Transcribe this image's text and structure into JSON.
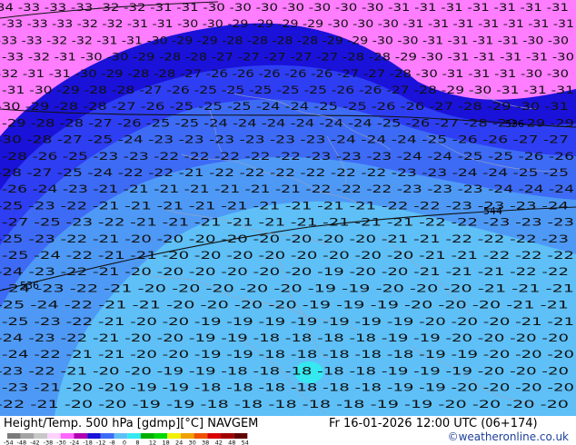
{
  "map": {
    "title": "Height/Temp. 500 hPa [gdmp][°C] NAVGEM",
    "valid_time": "Fr 16-01-2026 12:00 UTC (06+174)",
    "credit": "©weatheronline.co.uk",
    "fill_colors": [
      "#ff7dff",
      "#1a12d8",
      "#2e3ef3",
      "#3d6bf5",
      "#4e99f6",
      "#5ec0f7",
      "#36e8f0"
    ],
    "contour_labels": [
      {
        "text": "544"
      },
      {
        "text": "536"
      },
      {
        "text": "536"
      }
    ],
    "temperature_rows": [
      "34 -33 -33 -33 -32 -32 -31 -31 -30 -30 -30 -30 -30 -30 -30 -31 -31 -31 -31 -31 -31 -31",
      "-33 -33 -33 -32 -32 -31 -31 -30 -30 -29 -29 -29 -29 -30 -30 -30 -31 -31 -31 -31 -31 -31 -31",
      "-33 -33 -32 -32 -31 -31 -30 -29 -29 -28 -28 -28 -28 -29 -29 -30 -30 -31 -31 -31 -31 -30 -30",
      "-33 -32 -31 -30 -30 -29 -28 -28 -27 -27 -27 -27 -27 -28 -28 -29 -30 -31 -31 -31 -31 -30",
      "-32 -31 -31 -30 -29 -28 -28 -27 -26 -26 -26 -26 -26 -27 -27 -28 -30 -31 -31 -31 -30 -30",
      "-31 -30 -29 -28 -28 -27 -26 -25 -25 -25 -25 -25 -26 -26 -27 -28 -29 -30 -31 -31 -31",
      "-30 -29 -28 -28 -27 -26 -25 -25 -25 -24 -24 -25 -25 -26 -26 -27 -28 -29 -30 -31",
      "-29 -28 -28 -27 -26 -25 -25 -24 -24 -24 -24 -24 -24 -25 -26 -27 -28 -29 -29 -29",
      "-30 -28 -27 -25 -24 -23 -23 -23 -23 -23 -23 -24 -24 -24 -25 -26 -26 -27 -27",
      "-28 -26 -25 -23 -23 -22 -22 -22 -22 -22 -23 -23 -23 -24 -24 -25 -25 -26 -26",
      "-28 -27 -25 -24 -22 -22 -21 -22 -22 -22 -22 -22 -22 -23 -23 -24 -24 -25 -25",
      "-26 -24 -23 -21 -21 -21 -21 -21 -21 -21 -22 -22 -22 -23 -23 -23 -24 -24 -24",
      "-25 -23 -22 -21 -21 -21 -21 -21 -21 -21 -21 -21 -22 -22 -23 -23 -23 -24",
      "-27 -25 -23 -22 -21 -21 -21 -21 -21 -21 -21 -21 -21 -22 -22 -23 -23 -23",
      "-25 -23 -22 -21 -20 -20 -20 -20 -20 -20 -20 -20 -21 -21 -22 -22 -22 -23",
      "-25 -24 -22 -21 -21 -20 -20 -20 -20 -20 -20 -20 -20 -21 -21 -22 -22 -22",
      "-24 -23 -22 -21 -20 -20 -20 -20 -20 -20 -19 -20 -20 -21 -21 -21 -22 -22",
      "-24 -23 -22 -21 -20 -20 -20 -20 -20 -19 -19 -20 -20 -20 -21 -21 -21",
      "-25 -24 -22 -21 -21 -20 -20 -20 -20 -19 -19 -19 -20 -20 -20 -21 -21",
      "-25 -23 -22 -21 -20 -20 -19 -19 -19 -19 -19 -19 -19 -20 -20 -20 -21 -21",
      "-24 -23 -22 -21 -20 -20 -19 -19 -18 -18 -18 -18 -19 -19 -20 -20 -20 -20",
      "-24 -22 -21 -21 -20 -20 -19 -19 -18 -18 -18 -18 -18 -19 -19 -20 -20 -20",
      "-23 -22 -21 -20 -20 -19 -19 -18 -18 -18 -18 -18 -19 -19 -19 -20 -20 -20",
      "-23 -21 -20 -20 -19 -19 -18 -18 -18 -18 -18 -18 -19 -19 -20 -20 -20 -20",
      "-22 -21 -20 -20 -19 -19 -18 -18 -18 -18 -18 -19 -19 -20 -20 -20 -20"
    ]
  },
  "colorbar": {
    "ticks": [
      "-54",
      "-48",
      "-42",
      "-38",
      "-30",
      "-24",
      "-18",
      "-12",
      "-8",
      "0",
      "8",
      "12",
      "18",
      "24",
      "30",
      "38",
      "42",
      "48",
      "54"
    ],
    "colors": [
      "#7a7a7a",
      "#a3a3a3",
      "#c7c7c7",
      "#ffd1ff",
      "#ff66ff",
      "#b000b0",
      "#1a12d8",
      "#3d6bf5",
      "#5ec0f7",
      "#36e8f0",
      "#00b000",
      "#00d800",
      "#f0f000",
      "#f0a000",
      "#f05000",
      "#d80000",
      "#a00000",
      "#600000"
    ]
  }
}
